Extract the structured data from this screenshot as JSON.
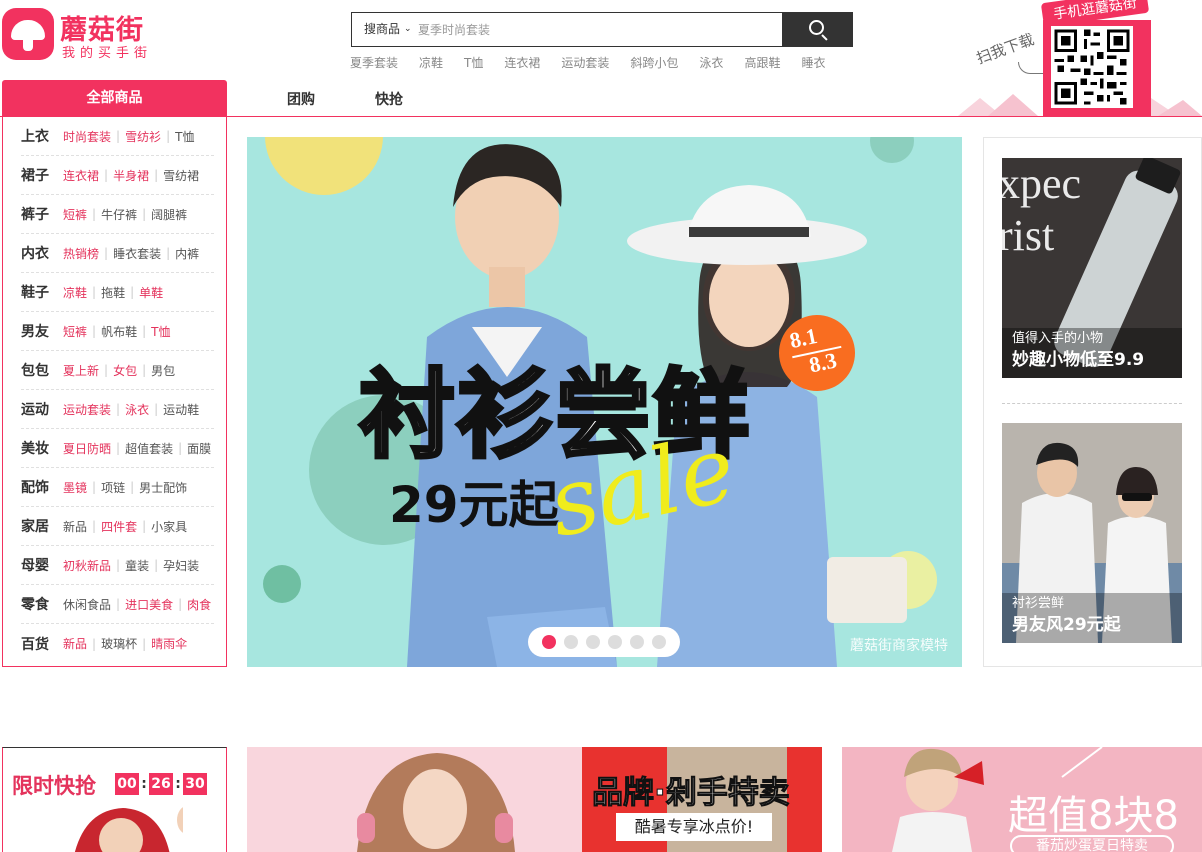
{
  "logo": {
    "title": "蘑菇街",
    "slogan": "我的买手街"
  },
  "search": {
    "type_label": "搜商品",
    "placeholder": "夏季时尚套装",
    "hot_words": [
      "夏季套装",
      "凉鞋",
      "T恤",
      "连衣裙",
      "运动套装",
      "斜跨小包",
      "泳衣",
      "高跟鞋",
      "睡衣"
    ]
  },
  "qr": {
    "tag": "手机逛蘑菇街",
    "scan_text": "扫我下载"
  },
  "nav": {
    "all_goods": "全部商品",
    "links": [
      "团购",
      "快抢"
    ]
  },
  "categories": [
    {
      "name": "上衣",
      "links": [
        {
          "t": "时尚套装",
          "hot": true
        },
        {
          "t": "雪纺衫",
          "hot": true
        },
        {
          "t": "T恤",
          "hot": false
        }
      ]
    },
    {
      "name": "裙子",
      "links": [
        {
          "t": "连衣裙",
          "hot": true
        },
        {
          "t": "半身裙",
          "hot": true
        },
        {
          "t": "雪纺裙",
          "hot": false
        }
      ]
    },
    {
      "name": "裤子",
      "links": [
        {
          "t": "短裤",
          "hot": true
        },
        {
          "t": "牛仔裤",
          "hot": false
        },
        {
          "t": "阔腿裤",
          "hot": false
        }
      ]
    },
    {
      "name": "内衣",
      "links": [
        {
          "t": "热销榜",
          "hot": true
        },
        {
          "t": "睡衣套装",
          "hot": false
        },
        {
          "t": "内裤",
          "hot": false
        }
      ]
    },
    {
      "name": "鞋子",
      "links": [
        {
          "t": "凉鞋",
          "hot": true
        },
        {
          "t": "拖鞋",
          "hot": false
        },
        {
          "t": "单鞋",
          "hot": true
        }
      ]
    },
    {
      "name": "男友",
      "links": [
        {
          "t": "短裤",
          "hot": true
        },
        {
          "t": "帆布鞋",
          "hot": false
        },
        {
          "t": "T恤",
          "hot": true
        }
      ]
    },
    {
      "name": "包包",
      "links": [
        {
          "t": "夏上新",
          "hot": true
        },
        {
          "t": "女包",
          "hot": true
        },
        {
          "t": "男包",
          "hot": false
        }
      ]
    },
    {
      "name": "运动",
      "links": [
        {
          "t": "运动套装",
          "hot": true
        },
        {
          "t": "泳衣",
          "hot": true
        },
        {
          "t": "运动鞋",
          "hot": false
        }
      ]
    },
    {
      "name": "美妆",
      "links": [
        {
          "t": "夏日防晒",
          "hot": true
        },
        {
          "t": "超值套装",
          "hot": false
        },
        {
          "t": "面膜",
          "hot": false
        }
      ]
    },
    {
      "name": "配饰",
      "links": [
        {
          "t": "墨镜",
          "hot": true
        },
        {
          "t": "项链",
          "hot": false
        },
        {
          "t": "男士配饰",
          "hot": false
        }
      ]
    },
    {
      "name": "家居",
      "links": [
        {
          "t": "新品",
          "hot": false
        },
        {
          "t": "四件套",
          "hot": true
        },
        {
          "t": "小家具",
          "hot": false
        }
      ]
    },
    {
      "name": "母婴",
      "links": [
        {
          "t": "初秋新品",
          "hot": true
        },
        {
          "t": "童装",
          "hot": false
        },
        {
          "t": "孕妇装",
          "hot": false
        }
      ]
    },
    {
      "name": "零食",
      "links": [
        {
          "t": "休闲食品",
          "hot": false
        },
        {
          "t": "进口美食",
          "hot": true
        },
        {
          "t": "肉食",
          "hot": true
        }
      ]
    },
    {
      "name": "百货",
      "links": [
        {
          "t": "新品",
          "hot": true
        },
        {
          "t": "玻璃杯",
          "hot": false
        },
        {
          "t": "晴雨伞",
          "hot": true
        }
      ]
    }
  ],
  "banner": {
    "title": "衬衫尝鲜",
    "price": "29元起",
    "sale_word": "sale",
    "date_top": "8.1",
    "date_bottom": "8.3",
    "caption": "蘑菇街商家模特",
    "slide_count": 6,
    "active_slide": 1
  },
  "side_promos": [
    {
      "sub": "值得入手的小物",
      "main": "妙趣小物低至9.9"
    },
    {
      "sub": "衬衫尝鲜",
      "main": "男友风29元起"
    }
  ],
  "flash_sale": {
    "title": "限时快抢",
    "hours": "00",
    "minutes": "26",
    "seconds": "30"
  },
  "brand_sale": {
    "title": "品牌·剁手特卖",
    "sub": "酷暑专享冰点价!"
  },
  "super_value": {
    "title": "超值8块8",
    "sub": "番茄炒蛋夏日特卖"
  },
  "colors": {
    "brand": "#f2325f",
    "hot_link": "#e4335c",
    "banner_bg": "#a7e6df",
    "badge": "#f96d20"
  }
}
